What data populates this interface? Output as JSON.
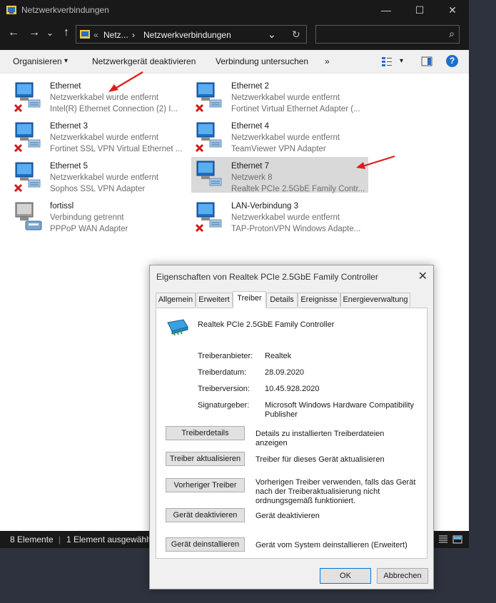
{
  "explorer": {
    "title": "Netzwerkverbindungen",
    "window_buttons": {
      "minimize": "—",
      "maximize": "☐",
      "close": "✕"
    },
    "nav": {
      "back": "←",
      "forward": "→",
      "recent": "⌄",
      "up": "↑"
    },
    "address": {
      "overflow": "«",
      "crumb1": "Netz...",
      "sep": "›",
      "crumb2": "Netzwerkverbindungen",
      "dropdown": "⌄",
      "refresh": "↻"
    },
    "search": {
      "icon": "⌕",
      "placeholder": ""
    },
    "toolbar": {
      "organize": "Organisieren",
      "organize_arrow": "▾",
      "disable": "Netzwerkgerät deaktivieren",
      "diagnose": "Verbindung untersuchen",
      "more": "»",
      "view_arrow": "▾",
      "help": "?"
    },
    "items": [
      {
        "name": "Ethernet",
        "status": "Netzwerkkabel wurde entfernt",
        "adapter": "Intel(R) Ethernet Connection (2) I..."
      },
      {
        "name": "Ethernet 2",
        "status": "Netzwerkkabel wurde entfernt",
        "adapter": "Fortinet Virtual Ethernet Adapter (..."
      },
      {
        "name": "Ethernet 3",
        "status": "Netzwerkkabel wurde entfernt",
        "adapter": "Fortinet SSL VPN Virtual Ethernet ..."
      },
      {
        "name": "Ethernet 4",
        "status": "Netzwerkkabel wurde entfernt",
        "adapter": "TeamViewer VPN Adapter"
      },
      {
        "name": "Ethernet 5",
        "status": "Netzwerkkabel wurde entfernt",
        "adapter": "Sophos SSL VPN Adapter"
      },
      {
        "name": "Ethernet 7",
        "status": "Netzwerk 8",
        "adapter": "Realtek PCIe 2.5GbE Family Contr..."
      },
      {
        "name": "fortissl",
        "status": "Verbindung getrennt",
        "adapter": "PPPoP WAN Adapter"
      },
      {
        "name": "LAN-Verbindung 3",
        "status": "Netzwerkkabel wurde entfernt",
        "adapter": "TAP-ProtonVPN Windows Adapte..."
      }
    ],
    "statusbar": {
      "count": "8 Elemente",
      "selected": "1 Element ausgewählt"
    }
  },
  "dialog": {
    "title": "Eigenschaften von Realtek PCIe 2.5GbE Family Controller",
    "close": "✕",
    "tabs": [
      "Allgemein",
      "Erweitert",
      "Treiber",
      "Details",
      "Ereignisse",
      "Energieverwaltung"
    ],
    "device_name": "Realtek PCIe 2.5GbE Family Controller",
    "fields": {
      "provider_label": "Treiberanbieter:",
      "provider": "Realtek",
      "date_label": "Treiberdatum:",
      "date": "28.09.2020",
      "version_label": "Treiberversion:",
      "version": "10.45.928.2020",
      "signer_label": "Signaturgeber:",
      "signer": "Microsoft Windows Hardware Compatibility Publisher"
    },
    "actions": [
      {
        "button": "Treiberdetails",
        "desc": "Details zu installierten Treiberdateien anzeigen"
      },
      {
        "button": "Treiber aktualisieren",
        "desc": "Treiber für dieses Gerät aktualisieren"
      },
      {
        "button": "Vorheriger Treiber",
        "desc": "Vorherigen Treiber verwenden, falls das Gerät nach der Treiberaktualisierung nicht ordnungsgemäß funktioniert."
      },
      {
        "button": "Gerät deaktivieren",
        "desc": "Gerät deaktivieren"
      },
      {
        "button": "Gerät deinstallieren",
        "desc": "Gerät vom System deinstallieren (Erweitert)"
      }
    ],
    "ok": "OK",
    "cancel": "Abbrechen"
  }
}
